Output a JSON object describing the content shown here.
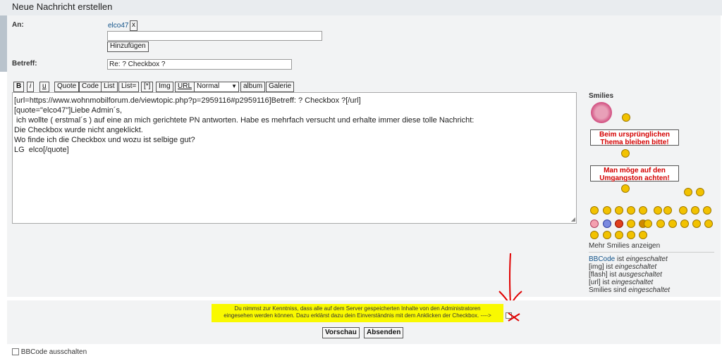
{
  "header": {
    "title": "Neue Nachricht erstellen"
  },
  "to": {
    "label": "An:",
    "recipient": "elco47",
    "remove": "x",
    "add_button": "Hinzufügen"
  },
  "subject": {
    "label": "Betreff:",
    "value": "Re: ? Checkbox ?"
  },
  "toolbar": {
    "bold": "B",
    "italic": "i",
    "underline": "u",
    "quote": "Quote",
    "code": "Code",
    "list": "List",
    "list_eq": "List=",
    "star": "[*]",
    "img": "Img",
    "url": "URL",
    "size": "Normal",
    "album": "album",
    "galerie": "Galerie"
  },
  "editor": {
    "lines": [
      "[url=https://www.wohnmobilforum.de/viewtopic.php?p=2959116#p2959116]Betreff: ? Checkbox ?[/url]",
      "",
      "[quote=\"elco47\"]Liebe Admin´s,",
      "",
      " ich wollte ( erstmal´s ) auf eine an mich gerichtete PN antworten. Habe es mehrfach versucht und erhalte immer diese tolle Nachricht:",
      "",
      "Die Checkbox wurde nicht angeklickt.",
      "",
      "Wo finde ich die Checkbox und wozu ist selbige gut?",
      "",
      "LG  elco[/quote]"
    ]
  },
  "smilies": {
    "title": "Smilies",
    "sign1": "Beim ursprünglichen Thema bleiben bitte!",
    "sign2": "Man möge auf den Umgangston achten!",
    "more": "Mehr Smilies anzeigen"
  },
  "status": {
    "bbcode": "BBCode",
    "bbcode_ist": " ist ",
    "bbcode_state": "eingeschaltet",
    "img": "[img] ist ",
    "img_state": "eingeschaltet",
    "flash": "[flash] ist ",
    "flash_state": "ausgeschaltet",
    "url": "[url] ist ",
    "url_state": "eingeschaltet",
    "smilies": "Smilies sind ",
    "smilies_state": "eingeschaltet"
  },
  "consent": {
    "line1": "Du nimmst zur Kenntniss, dass alle auf dem Server gespeicherten Inhalte von den Administratoren",
    "line2": "eingesehen werden können. Dazu erklärst dazu dein Einverständnis mit dem Anklicken der Checkbox.  ---->"
  },
  "actions": {
    "preview": "Vorschau",
    "submit": "Absenden"
  },
  "options": {
    "bbcode_off": "BBCode ausschalten"
  },
  "colors": {
    "highlight": "#f9f900",
    "annotation": "#e00000",
    "link": "#105289"
  }
}
